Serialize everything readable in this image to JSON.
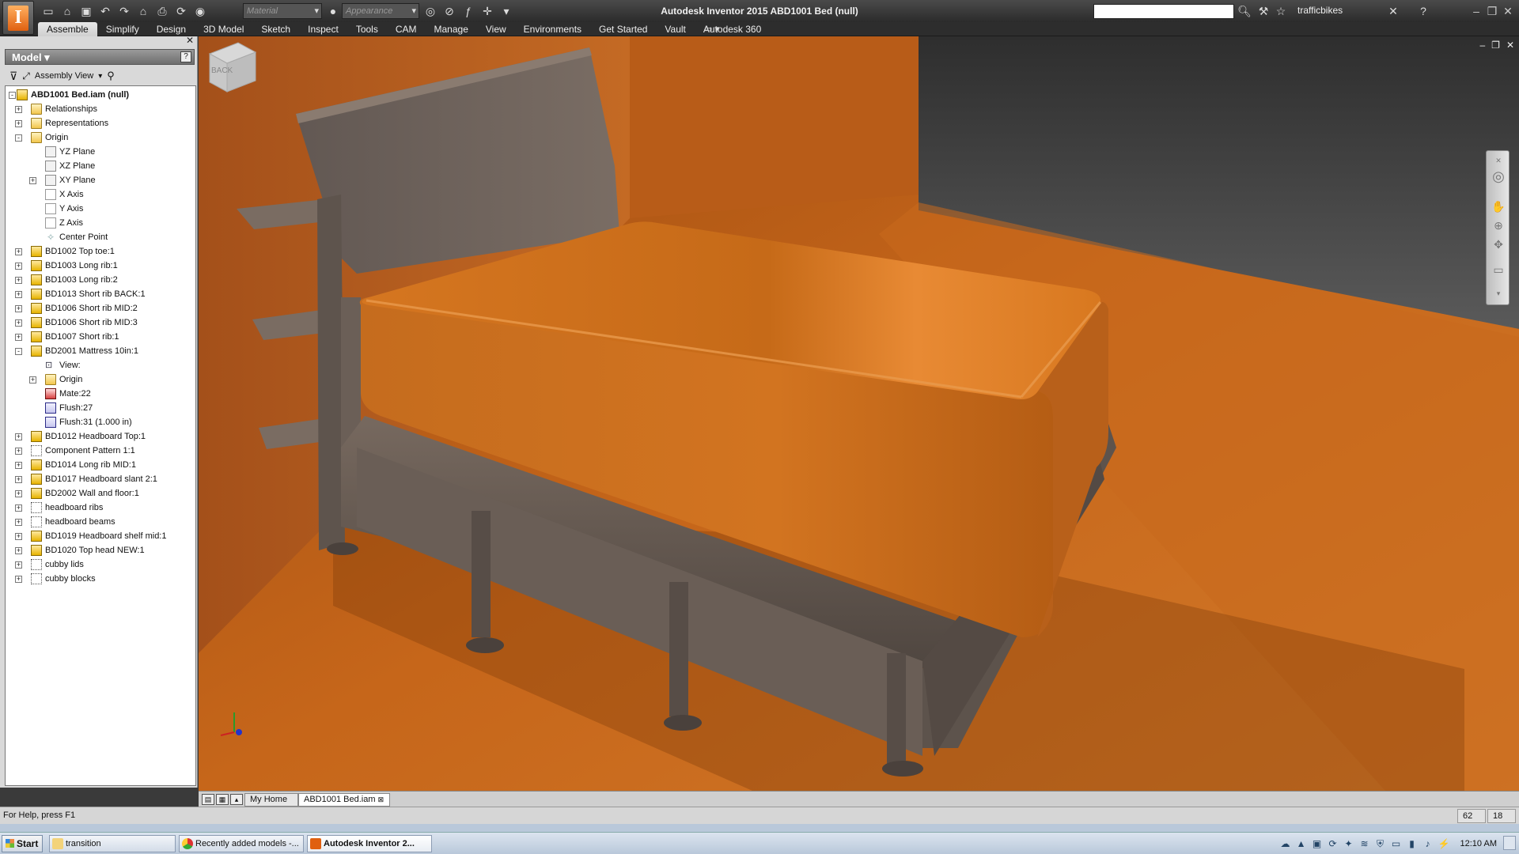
{
  "app": {
    "title": "Autodesk Inventor 2015   ABD1001 Bed (null)",
    "logo_letter": "I",
    "material_placeholder": "Material",
    "appearance_placeholder": "Appearance",
    "user": "trafficbikes"
  },
  "ribbon": {
    "tabs": [
      "Assemble",
      "Simplify",
      "Design",
      "3D Model",
      "Sketch",
      "Inspect",
      "Tools",
      "CAM",
      "Manage",
      "View",
      "Environments",
      "Get Started",
      "Vault",
      "Autodesk 360"
    ],
    "active_tab": "Assemble"
  },
  "model_panel": {
    "title": "Model",
    "view_label": "Assembly View",
    "tree": [
      {
        "level": 0,
        "label": "ABD1001 Bed.iam (null)",
        "icon": "assembly-icon",
        "exp": "-"
      },
      {
        "level": 1,
        "label": "Relationships",
        "icon": "folder-icon",
        "exp": "+"
      },
      {
        "level": 1,
        "label": "Representations",
        "icon": "representations-icon",
        "exp": "+"
      },
      {
        "level": 1,
        "label": "Origin",
        "icon": "folder-icon",
        "exp": "-"
      },
      {
        "level": 2,
        "label": "YZ Plane",
        "icon": "plane-icon",
        "exp": ""
      },
      {
        "level": 2,
        "label": "XZ Plane",
        "icon": "plane-icon",
        "exp": ""
      },
      {
        "level": 2,
        "label": "XY Plane",
        "icon": "plane-icon",
        "exp": "+"
      },
      {
        "level": 2,
        "label": "X Axis",
        "icon": "axis-icon",
        "exp": ""
      },
      {
        "level": 2,
        "label": "Y Axis",
        "icon": "axis-icon",
        "exp": ""
      },
      {
        "level": 2,
        "label": "Z Axis",
        "icon": "axis-icon",
        "exp": ""
      },
      {
        "level": 2,
        "label": "Center Point",
        "icon": "point-icon",
        "exp": ""
      },
      {
        "level": 1,
        "label": "BD1002 Top toe:1",
        "icon": "part-icon",
        "exp": "+"
      },
      {
        "level": 1,
        "label": "BD1003 Long rib:1",
        "icon": "part-icon",
        "exp": "+"
      },
      {
        "level": 1,
        "label": "BD1003 Long rib:2",
        "icon": "part-icon",
        "exp": "+"
      },
      {
        "level": 1,
        "label": "BD1013 Short rib BACK:1",
        "icon": "part-icon",
        "exp": "+"
      },
      {
        "level": 1,
        "label": "BD1006 Short rib MID:2",
        "icon": "part-icon",
        "exp": "+"
      },
      {
        "level": 1,
        "label": "BD1006 Short rib MID:3",
        "icon": "part-icon",
        "exp": "+"
      },
      {
        "level": 1,
        "label": "BD1007 Short rib:1",
        "icon": "part-icon",
        "exp": "+"
      },
      {
        "level": 1,
        "label": "BD2001 Mattress 10in:1",
        "icon": "part-icon",
        "exp": "-"
      },
      {
        "level": 2,
        "label": "View:",
        "icon": "view-icon",
        "exp": ""
      },
      {
        "level": 2,
        "label": "Origin",
        "icon": "folder-icon",
        "exp": "+"
      },
      {
        "level": 2,
        "label": "Mate:22",
        "icon": "mate-icon",
        "exp": ""
      },
      {
        "level": 2,
        "label": "Flush:27",
        "icon": "flush-icon",
        "exp": ""
      },
      {
        "level": 2,
        "label": "Flush:31 (1.000 in)",
        "icon": "flush-icon",
        "exp": ""
      },
      {
        "level": 1,
        "label": "BD1012 Headboard Top:1",
        "icon": "part-icon",
        "exp": "+"
      },
      {
        "level": 1,
        "label": "Component Pattern 1:1",
        "icon": "pattern-icon",
        "exp": "+"
      },
      {
        "level": 1,
        "label": "BD1014 Long rib MID:1",
        "icon": "part-icon",
        "exp": "+"
      },
      {
        "level": 1,
        "label": "BD1017 Headboard slant 2:1",
        "icon": "part-icon",
        "exp": "+"
      },
      {
        "level": 1,
        "label": "BD2002 Wall and floor:1",
        "icon": "part-icon",
        "exp": "+"
      },
      {
        "level": 1,
        "label": "headboard ribs",
        "icon": "pattern-icon",
        "exp": "+"
      },
      {
        "level": 1,
        "label": "headboard beams",
        "icon": "pattern-icon",
        "exp": "+"
      },
      {
        "level": 1,
        "label": "BD1019 Headboard shelf mid:1",
        "icon": "part-icon",
        "exp": "+"
      },
      {
        "level": 1,
        "label": "BD1020 Top head NEW:1",
        "icon": "part-icon",
        "exp": "+"
      },
      {
        "level": 1,
        "label": "cubby lids",
        "icon": "pattern-icon",
        "exp": "+"
      },
      {
        "level": 1,
        "label": "cubby blocks",
        "icon": "pattern-icon",
        "exp": "+"
      }
    ]
  },
  "viewcube": {
    "face_label": "BACK"
  },
  "doc_tabs": [
    {
      "label": "My Home",
      "active": false
    },
    {
      "label": "ABD1001 Bed.iam",
      "active": true
    }
  ],
  "status": {
    "help_text": "For Help, press F1",
    "count_a": "62",
    "count_b": "18"
  },
  "taskbar": {
    "start_label": "Start",
    "tasks": [
      {
        "label": "transition",
        "active": false
      },
      {
        "label": "Recently added models -...",
        "active": false
      },
      {
        "label": "Autodesk Inventor 2...",
        "active": true
      }
    ],
    "clock": "12:10 AM"
  },
  "colors": {
    "mattress": "#d97a1f",
    "floor": "#c56a1c",
    "wood": "#6e625b",
    "accent": "#e06010"
  }
}
